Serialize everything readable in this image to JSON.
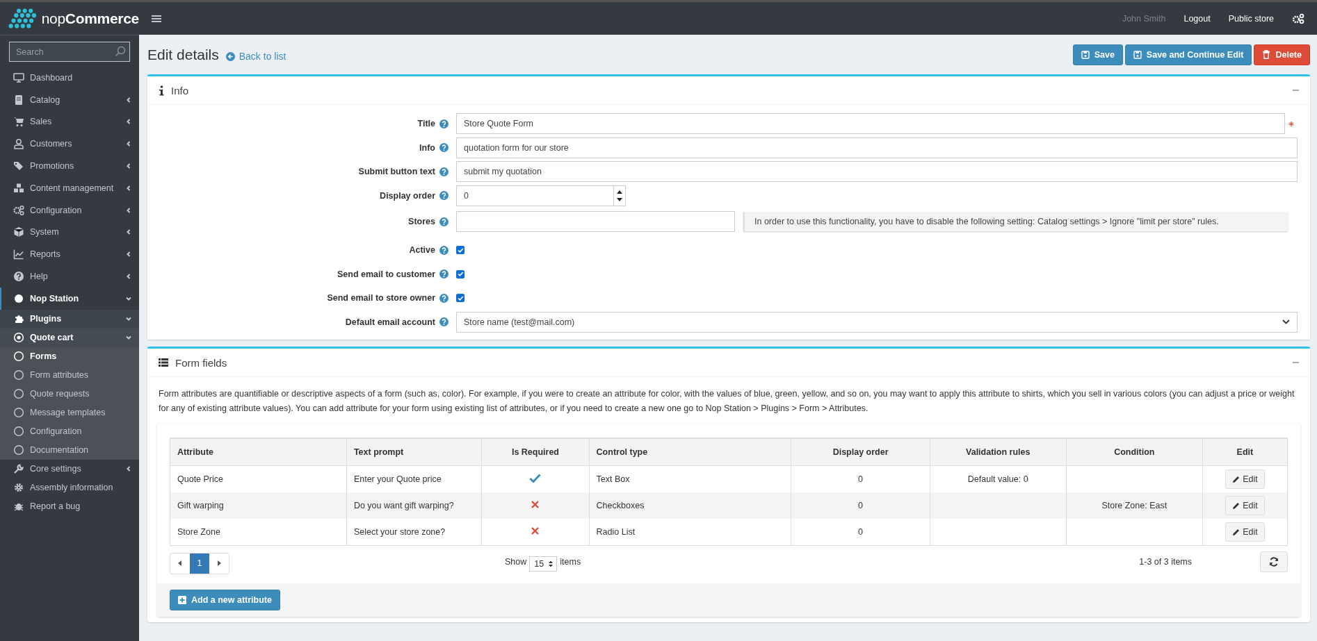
{
  "brand": {
    "logo_text": "nop**Commerce**"
  },
  "sidebar": {
    "search_placeholder": "Search",
    "items": [
      {
        "label": "Dashboard",
        "selected": false
      },
      {
        "label": "Catalog",
        "selected": false,
        "expanded": false
      },
      {
        "label": "Sales",
        "selected": false,
        "expanded": false
      },
      {
        "label": "Customers",
        "selected": false,
        "expanded": false
      },
      {
        "label": "Promotions",
        "selected": false,
        "expanded": false
      },
      {
        "label": "Content management",
        "selected": false,
        "expanded": false
      },
      {
        "label": "Configuration",
        "selected": false,
        "expanded": false
      },
      {
        "label": "System",
        "selected": false,
        "expanded": false
      },
      {
        "label": "Reports",
        "selected": false,
        "expanded": false
      },
      {
        "label": "Help",
        "selected": false,
        "expanded": false
      },
      {
        "label": "Nop Station",
        "selected": false,
        "expanded": true,
        "children": [
          {
            "label": "Plugins",
            "selected": false,
            "expanded": true,
            "children": [
              {
                "label": "Quote cart",
                "selected": false,
                "expanded": true,
                "children": [
                  {
                    "label": "Forms",
                    "selected": true
                  },
                  {
                    "label": "Form attributes",
                    "selected": false
                  },
                  {
                    "label": "Quote requests",
                    "selected": false
                  },
                  {
                    "label": "Message templates",
                    "selected": false
                  },
                  {
                    "label": "Configuration",
                    "selected": false
                  },
                  {
                    "label": "Documentation",
                    "selected": false
                  }
                ]
              }
            ]
          },
          {
            "label": "Core settings",
            "selected": false,
            "expanded": false
          },
          {
            "label": "Assembly information",
            "selected": false
          },
          {
            "label": "Report a bug",
            "selected": false
          }
        ]
      }
    ]
  },
  "header": {
    "user": "John Smith",
    "links": [
      "Logout",
      "Public store"
    ]
  },
  "page": {
    "title": "Edit details",
    "back_link": "Back to list",
    "buttons": [
      {
        "label": "Save",
        "kind": "primary"
      },
      {
        "label": "Save and Continue Edit",
        "kind": "primary"
      },
      {
        "label": "Delete",
        "kind": "danger"
      }
    ]
  },
  "info": {
    "title": "Info",
    "fields": [
      {
        "label": "Title",
        "kind": "text",
        "value": "Store Quote Form",
        "required": true
      },
      {
        "label": "Info",
        "kind": "text",
        "value": "quotation form for our store"
      },
      {
        "label": "Submit button text",
        "kind": "text",
        "value": "submit my quotation"
      },
      {
        "label": "Display order",
        "kind": "number",
        "value": "0"
      },
      {
        "label": "Stores",
        "kind": "stores",
        "note": "In order to use this functionality, you have to disable the following setting: Catalog settings > Ignore \"limit per store\" rules."
      },
      {
        "label": "Active",
        "kind": "checkbox",
        "checked": true
      },
      {
        "label": "Send email to customer",
        "kind": "checkbox",
        "checked": true
      },
      {
        "label": "Send email to store owner",
        "kind": "checkbox",
        "checked": true
      },
      {
        "label": "Default email account",
        "kind": "select",
        "value": "Store name (test@mail.com)"
      }
    ]
  },
  "form_fields": {
    "title": "Form fields",
    "description": "Form attributes are quantifiable or descriptive aspects of a form (such as, color). For example, if you were to create an attribute for color, with the values of blue, green, yellow, and so on, you may want to apply this attribute to shirts, which you sell in various colors (you can adjust a price or weight for any of existing attribute values). You can add attribute for your form using existing list of attributes, or if you need to create a new one go to Nop Station > Plugins > Form > Attributes.",
    "table": {
      "columns": [
        "Attribute",
        "Text prompt",
        "Is Required",
        "Control type",
        "Display order",
        "Validation rules",
        "Condition",
        "Edit"
      ],
      "rows": [
        {
          "attribute": "Quote Price",
          "text_prompt": "Enter your Quote price",
          "required": true,
          "control_type": "Text Box",
          "display_order": "0",
          "validation_rules": "Default value: 0",
          "action": "Edit"
        },
        {
          "attribute": "Gift warping",
          "text_prompt": "Do you want gift warping?",
          "required": false,
          "control_type": "Checkboxes",
          "display_order": "0",
          "condition": "Store Zone: East",
          "action": "Edit"
        },
        {
          "attribute": "Store Zone",
          "text_prompt": "Select your store zone?",
          "required": false,
          "control_type": "Radio List",
          "display_order": "0",
          "action": "Edit"
        }
      ]
    },
    "pager": {
      "pages": [
        {
          "label": "1",
          "selected": true
        }
      ],
      "show_label": "Show",
      "page_size": "15",
      "items_label": "items",
      "summary": "1-3 of 3 items"
    },
    "add_button": "Add a new attribute"
  }
}
